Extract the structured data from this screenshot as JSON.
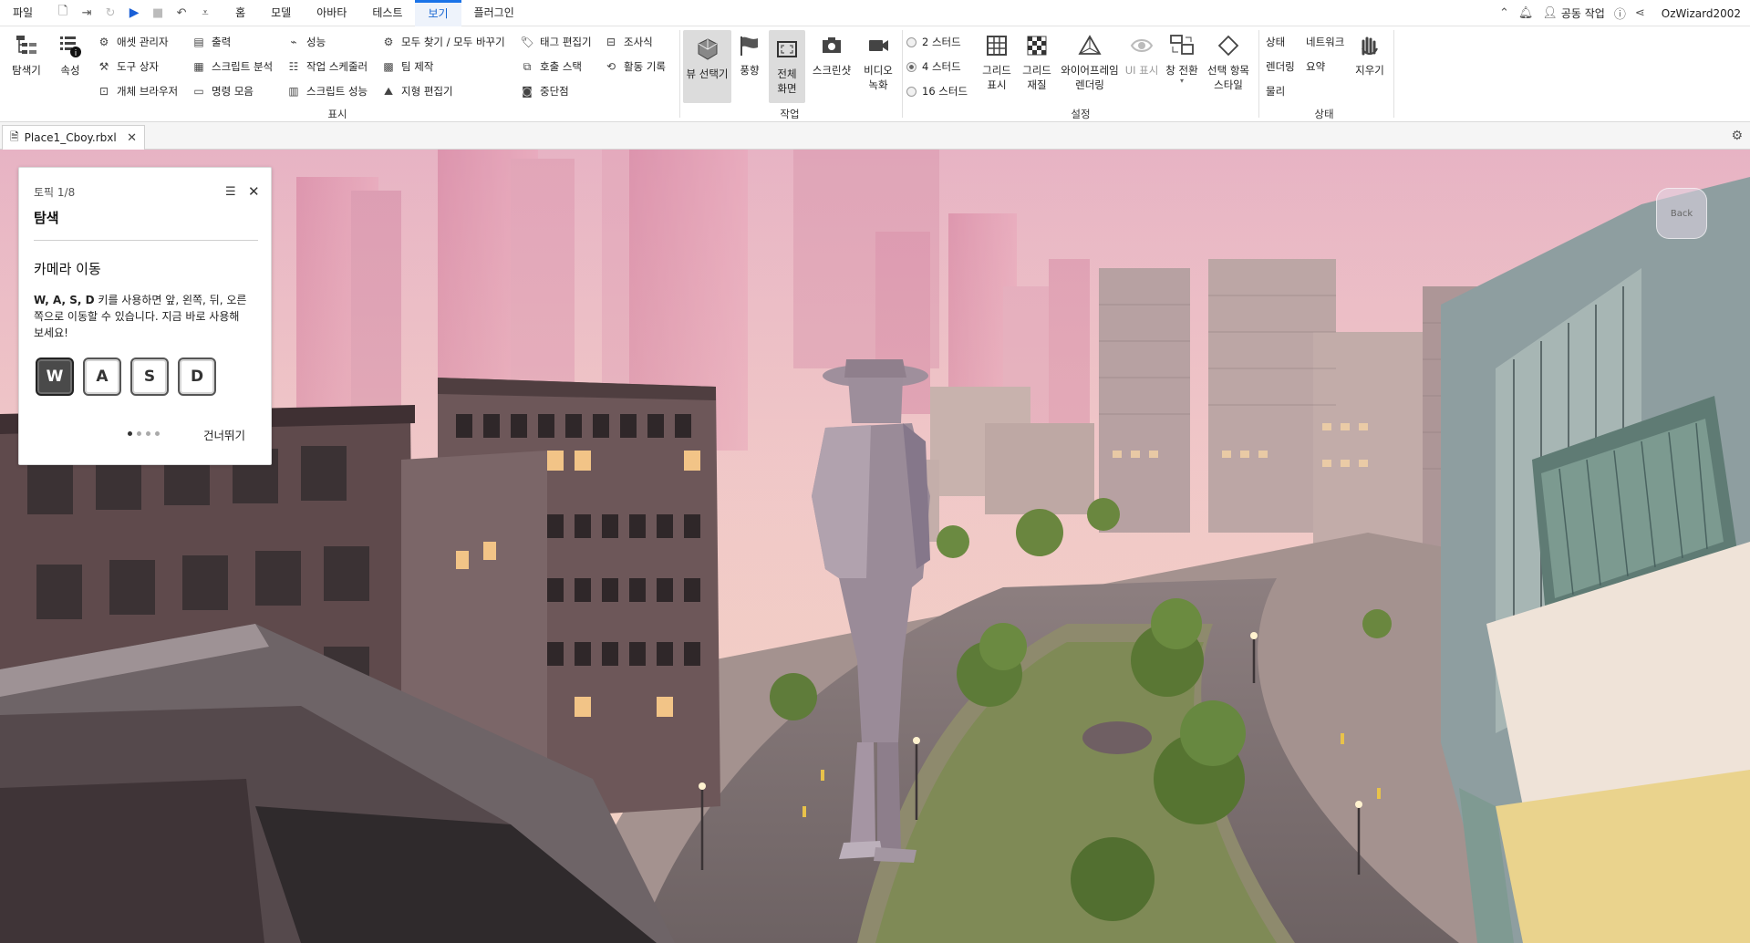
{
  "menubar": {
    "items": [
      "파일",
      "홈",
      "모델",
      "아바타",
      "테스트",
      "보기",
      "플러그인"
    ],
    "active": "보기",
    "collab_label": "공동 작업",
    "username": "OzWizard2002"
  },
  "ribbon": {
    "explorer": "탐색기",
    "properties": "속성",
    "asset_manager": "애셋 관리자",
    "toolbox": "도구 상자",
    "object_browser": "개체 브라우저",
    "output": "출력",
    "script_analysis": "스크립트 분석",
    "command_bar": "명령 모음",
    "performance": "성능",
    "task_scheduler": "작업 스케줄러",
    "script_performance": "스크립트 성능",
    "find_replace_all": "모두 찾기 / 모두 바꾸기",
    "team_create": "팀 제작",
    "terrain_editor": "지형 편집기",
    "tag_editor": "태그 편집기",
    "call_stack": "호출 스택",
    "breakpoints": "중단점",
    "watch": "조사식",
    "activity_history": "활동 기록",
    "group_show": "표시",
    "view_selector": "뷰 선택기",
    "wind": "풍향",
    "full_screen_l1": "전체",
    "full_screen_l2": "화면",
    "screenshot": "스크린샷",
    "video_l1": "비디오",
    "video_l2": "녹화",
    "group_actions": "작업",
    "stud_2": "2 스터드",
    "stud_4": "4 스터드",
    "stud_16": "16 스터드",
    "show_grid_l1": "그리드",
    "show_grid_l2": "표시",
    "grid_material_l1": "그리드",
    "grid_material_l2": "재질",
    "wireframe_l1": "와이어프레임",
    "wireframe_l2": "렌더링",
    "ui_visibility": "UI 표시",
    "window_switch": "창 전환",
    "selection_style_l1": "선택 항목",
    "selection_style_l2": "스타일",
    "group_settings": "설정",
    "stats": "상태",
    "network": "네트워크",
    "render": "렌더링",
    "summary": "요약",
    "physics": "물리",
    "clear": "지우기",
    "group_stats": "상태"
  },
  "document_tab": {
    "title": "Place1_Cboy.rbxl"
  },
  "tutorial": {
    "step": "토픽 1/8",
    "title": "탐색",
    "heading": "카메라 이동",
    "body_keys": "W, A, S, D",
    "body_text": " 키를 사용하면 앞, 왼쪽, 뒤, 오른쪽으로 이동할 수 있습니다. 지금 바로 사용해 보세요!",
    "keys": [
      "W",
      "A",
      "S",
      "D"
    ],
    "pressed_key": "W",
    "total_steps": 4,
    "current_step": 1,
    "skip_label": "건너뛰기"
  },
  "viewcube_label": "Back",
  "colors": {
    "accent": "#1a73e8",
    "sky_top": "#e9b7c6",
    "sky_bottom": "#f2cfc1"
  }
}
